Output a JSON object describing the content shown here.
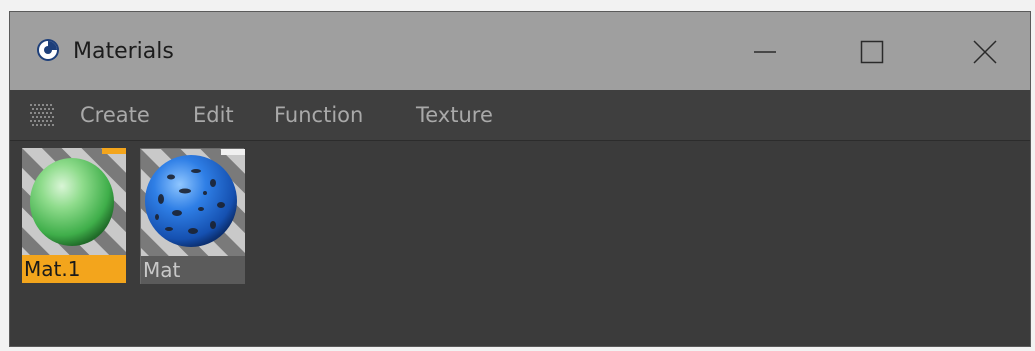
{
  "window": {
    "title": "Materials",
    "icon": "cinema4d-icon",
    "controls": [
      "minimize-icon",
      "maximize-icon",
      "close-icon"
    ]
  },
  "menu": {
    "items": [
      {
        "label": "Create"
      },
      {
        "label": "Edit"
      },
      {
        "label": "Function"
      },
      {
        "label": "Texture"
      }
    ]
  },
  "materials": [
    {
      "name": "Mat.1",
      "color": "#6fd27a",
      "selected": true
    },
    {
      "name": "Mat",
      "color": "#2f7fe6",
      "selected": false
    }
  ],
  "colors": {
    "titlebar": "#9f9f9f",
    "panel": "#3b3b3b",
    "selection": "#f3a51c"
  }
}
